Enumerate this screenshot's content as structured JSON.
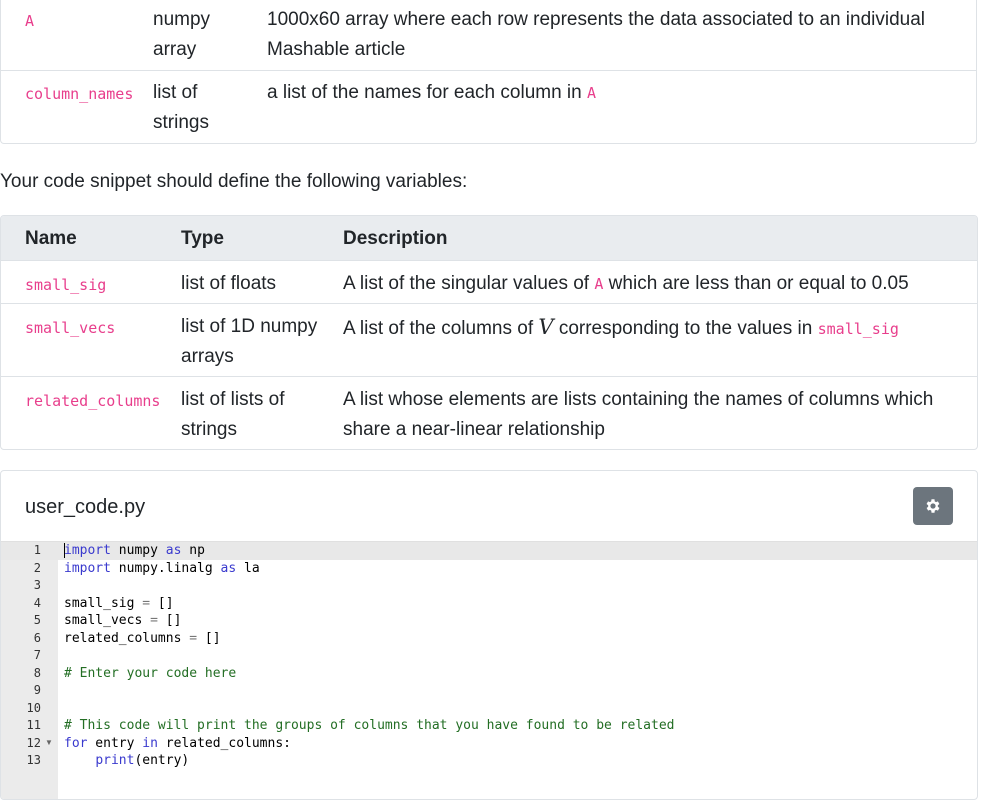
{
  "input_table": {
    "rows": [
      {
        "name": "A",
        "type": "numpy array",
        "desc": "1000x60 array where each row represents the data associated to an individual Mashable article"
      },
      {
        "name": "column_names",
        "type": "list of strings",
        "desc_prefix": "a list of the names for each column in ",
        "desc_code": "A"
      }
    ]
  },
  "lead_text": "Your code snippet should define the following variables:",
  "output_table": {
    "headers": {
      "name": "Name",
      "type": "Type",
      "desc": "Description"
    },
    "rows": [
      {
        "name": "small_sig",
        "type": "list of floats",
        "desc_a": "A list of the singular values of ",
        "desc_code": "A",
        "desc_b": " which are less than or equal to 0.05"
      },
      {
        "name": "small_vecs",
        "type": "list of 1D numpy arrays",
        "desc_a": "A list of the columns of ",
        "desc_var": "V",
        "desc_b": " corresponding to the values in ",
        "desc_code": "small_sig"
      },
      {
        "name": "related_columns",
        "type": "list of lists of strings",
        "desc": "A list whose elements are lists containing the names of columns which share a near-linear relationship"
      }
    ]
  },
  "editor": {
    "filename": "user_code.py",
    "settings_icon": "gear-icon",
    "lines": [
      {
        "n": "1",
        "code": "import numpy as np"
      },
      {
        "n": "2",
        "code": "import numpy.linalg as la"
      },
      {
        "n": "3",
        "code": ""
      },
      {
        "n": "4",
        "code": "small_sig = []"
      },
      {
        "n": "5",
        "code": "small_vecs = []"
      },
      {
        "n": "6",
        "code": "related_columns = []"
      },
      {
        "n": "7",
        "code": ""
      },
      {
        "n": "8",
        "code": "# Enter your code here"
      },
      {
        "n": "9",
        "code": ""
      },
      {
        "n": "10",
        "code": ""
      },
      {
        "n": "11",
        "code": "# This code will print the groups of columns that you have found to be related"
      },
      {
        "n": "12",
        "code": "for entry in related_columns:"
      },
      {
        "n": "13",
        "code": "    print(entry)"
      }
    ]
  }
}
